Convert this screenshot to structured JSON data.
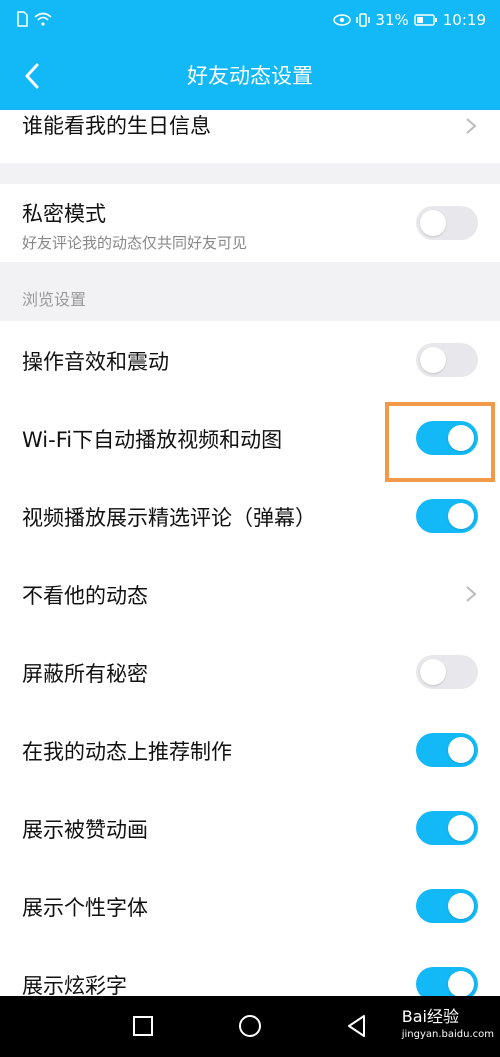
{
  "status_bar": {
    "battery_percent": "31%",
    "time": "10:19"
  },
  "app_bar": {
    "title": "好友动态设置"
  },
  "rows": {
    "birthday": {
      "label": "谁能看我的生日信息"
    },
    "private_mode": {
      "label": "私密模式",
      "sub": "好友评论我的动态仅共同好友可见",
      "on": false
    },
    "browse_section": {
      "label": "浏览设置"
    },
    "sound_vibration": {
      "label": "操作音效和震动",
      "on": false
    },
    "wifi_autoplay": {
      "label": "Wi-Fi下自动播放视频和动图",
      "on": true
    },
    "danmaku": {
      "label": "视频播放展示精选评论（弹幕）",
      "on": true
    },
    "hide_their_feed": {
      "label": "不看他的动态"
    },
    "block_secrets": {
      "label": "屏蔽所有秘密",
      "on": false
    },
    "recommend_creation": {
      "label": "在我的动态上推荐制作",
      "on": true
    },
    "like_animation": {
      "label": "展示被赞动画",
      "on": true
    },
    "custom_font": {
      "label": "展示个性字体",
      "on": true
    },
    "colorful_text": {
      "label": "展示炫彩字",
      "on": true
    }
  },
  "watermark": {
    "brand": "Bai经验",
    "url": "jingyan.baidu.com"
  },
  "colors": {
    "accent": "#13b9f7",
    "highlight_box": "#f39a4a"
  }
}
